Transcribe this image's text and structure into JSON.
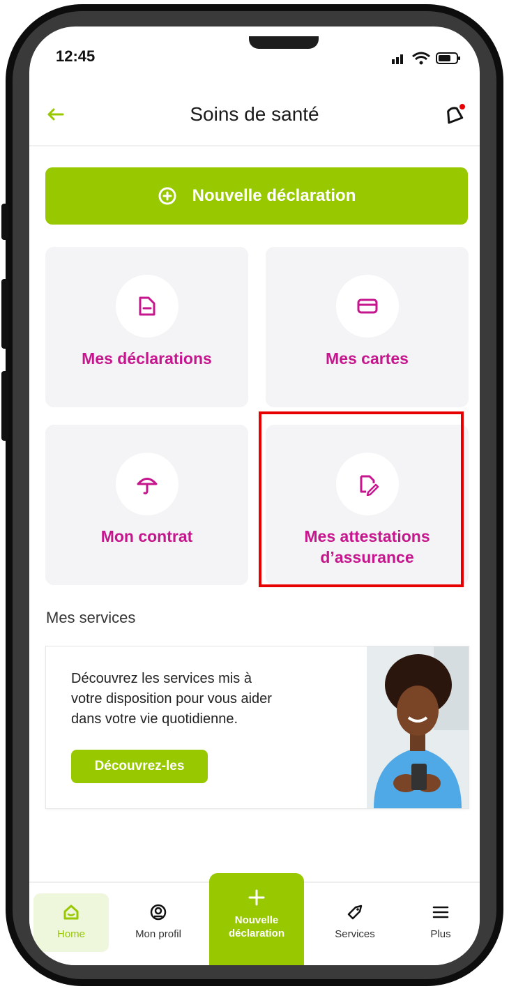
{
  "status_bar": {
    "time": "12:45"
  },
  "header": {
    "title": "Soins de santé"
  },
  "cta": {
    "label": "Nouvelle déclaration"
  },
  "tiles": [
    {
      "label": "Mes déclarations",
      "icon": "document-icon"
    },
    {
      "label": "Mes cartes",
      "icon": "card-icon"
    },
    {
      "label": "Mon contrat",
      "icon": "umbrella-icon"
    },
    {
      "label_line1": "Mes attestations",
      "label_line2": "d’assurance",
      "icon": "attestation-edit-icon"
    }
  ],
  "services": {
    "section_title": "Mes services",
    "text_line1": "Découvrez les services mis à",
    "text_line2": "votre disposition pour vous aider",
    "text_line3": "dans votre vie quotidienne.",
    "button": "Découvrez-les"
  },
  "bottom_nav": {
    "items": [
      {
        "label": "Home",
        "icon": "home-icon",
        "active": true
      },
      {
        "label": "Mon profil",
        "icon": "profile-icon"
      },
      {
        "label_line1": "Nouvelle",
        "label_line2": "déclaration",
        "icon": "plus-icon"
      },
      {
        "label": "Services",
        "icon": "tag-icon"
      },
      {
        "label": "Plus",
        "icon": "menu-icon"
      }
    ]
  },
  "colors": {
    "accent": "#97c800",
    "brand_pink": "#c6168d",
    "highlight": "#e60000",
    "tile_bg": "#f4f4f6"
  }
}
